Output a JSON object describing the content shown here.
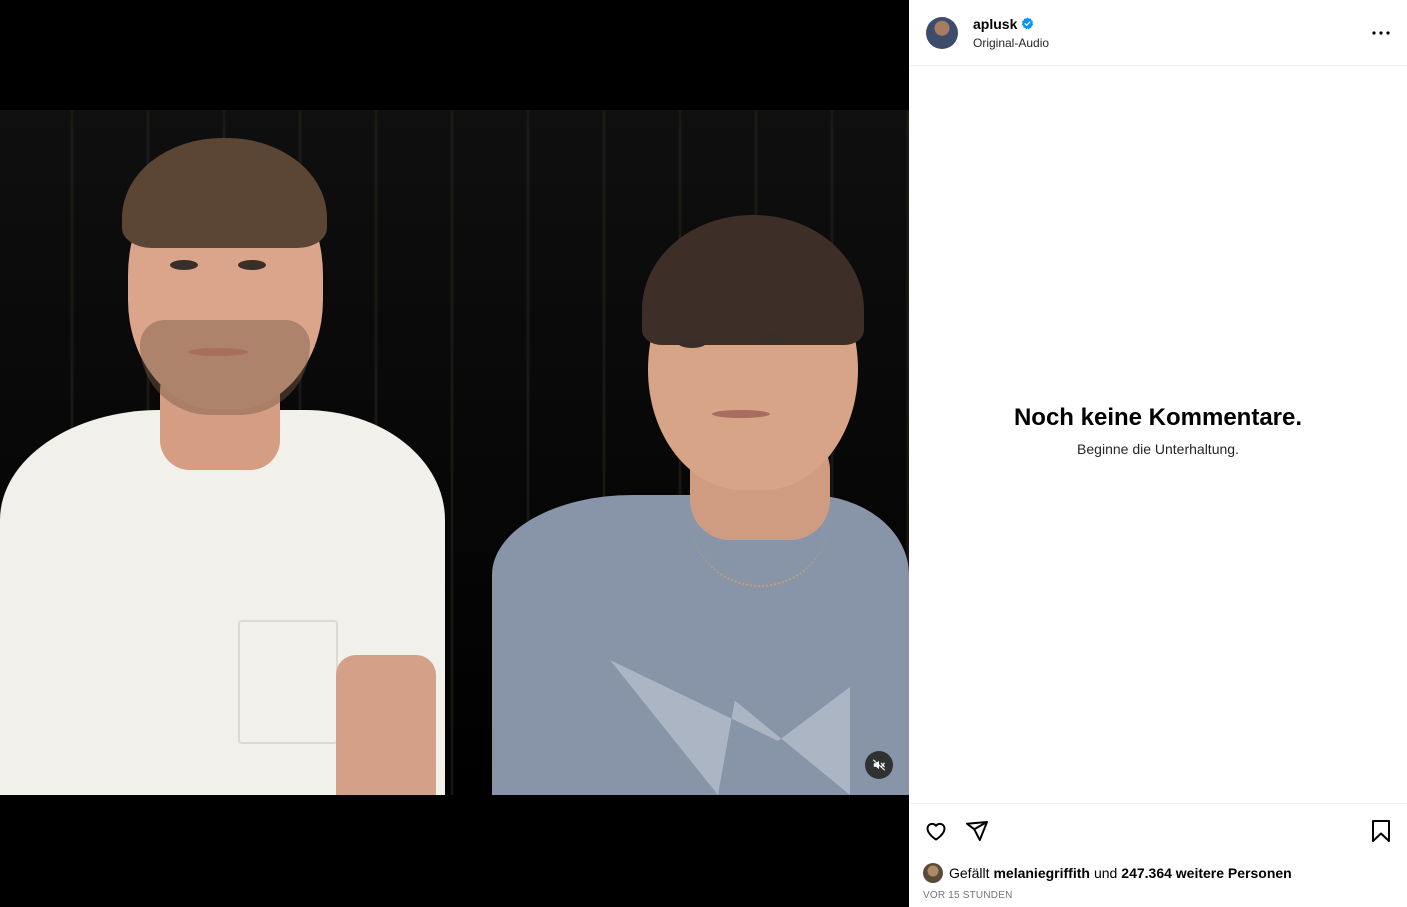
{
  "post": {
    "username": "aplusk",
    "audio": "Original-Audio",
    "verified": true
  },
  "comments": {
    "empty_title": "Noch keine Kommentare.",
    "empty_subtitle": "Beginne die Unterhaltung."
  },
  "likes": {
    "prefix": "Gefällt",
    "liker": "melaniegriffith",
    "connector": "und",
    "count_text": "247.364 weitere Personen"
  },
  "timestamp": "VOR 15 STUNDEN",
  "colors": {
    "verified_badge": "#0095f6",
    "divider": "#efefef",
    "secondary_text": "#737373"
  },
  "icons": {
    "more": "more-options-icon",
    "like": "heart-icon",
    "share": "send-icon",
    "save": "bookmark-icon",
    "mute": "muted-speaker-icon"
  }
}
